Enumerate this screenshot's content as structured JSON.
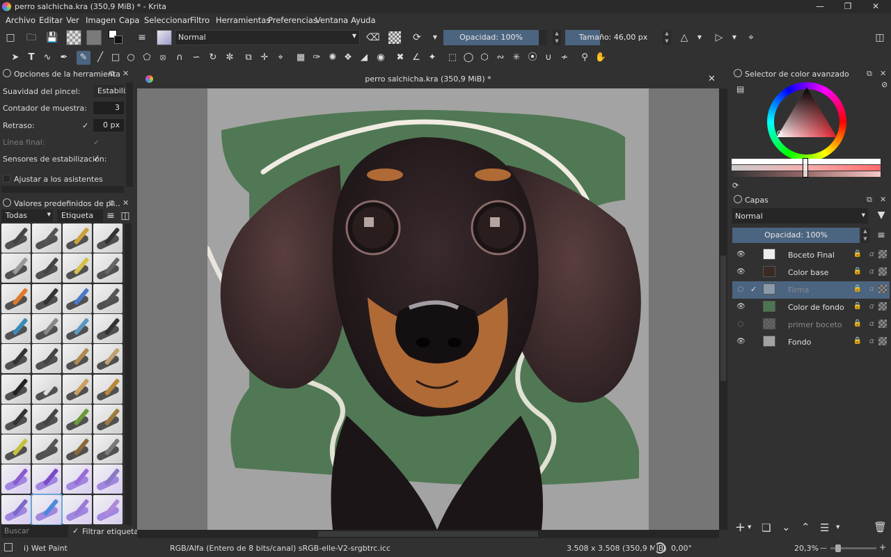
{
  "window": {
    "title": "perro salchicha.kra (350,9 MiB) * - Krita"
  },
  "menu": [
    "Archivo",
    "Editar",
    "Ver",
    "Imagen",
    "Capa",
    "Seleccionar",
    "Filtro",
    "Herramientas",
    "Preferencias",
    "Ventana",
    "Ayuda"
  ],
  "toolbar": {
    "blend_mode": "Normal",
    "opacity_label": "Opacidad: 100%",
    "size_label": "Tamaño: 46,00 px"
  },
  "tool_options": {
    "title": "Opciones de la herramienta",
    "rows": {
      "smoothing_label": "Suavidad del pincel:",
      "smoothing_value": "Estabiliz",
      "sample_label": "Contador de muestra:",
      "sample_value": "3",
      "delay_label": "Retraso:",
      "delay_value": "0 px",
      "end_label": "Línea final:",
      "sensors_label": "Sensores de estabilización:",
      "assistants_label": "Ajustar a los asistentes"
    }
  },
  "presets": {
    "title": "Valores predefinidos de pi...",
    "filter": "Todas",
    "tag": "Etiqueta",
    "search_placeholder": "Buscar",
    "filter_tag_label": "Filtrar etiqueta"
  },
  "canvas": {
    "tab_title": "perro salchicha.kra (350,9 MiB) *"
  },
  "color_selector": {
    "title": "Selector de color avanzado"
  },
  "layers": {
    "title": "Capas",
    "blend_mode": "Normal",
    "opacity_label": "Opacidad:  100%",
    "items": [
      {
        "name": "Boceto Final",
        "visible": true
      },
      {
        "name": "Color base",
        "visible": true
      },
      {
        "name": "Firma",
        "visible": false,
        "selected": true
      },
      {
        "name": "Color de fondo",
        "visible": true
      },
      {
        "name": "primer boceto",
        "visible": false
      },
      {
        "name": "Fondo",
        "visible": true
      }
    ]
  },
  "status": {
    "brush": "i) Wet Paint",
    "color_space": "RGB/Alfa (Entero de 8 bits/canal)  sRGB-elle-V2-srgbtrc.icc",
    "dimensions": "3.508 x 3.508 (350,9 MiB)",
    "rotation": "0,00°",
    "zoom": "20,3%"
  },
  "colors": {
    "accent": "#4b6480",
    "bg": "#313131"
  }
}
